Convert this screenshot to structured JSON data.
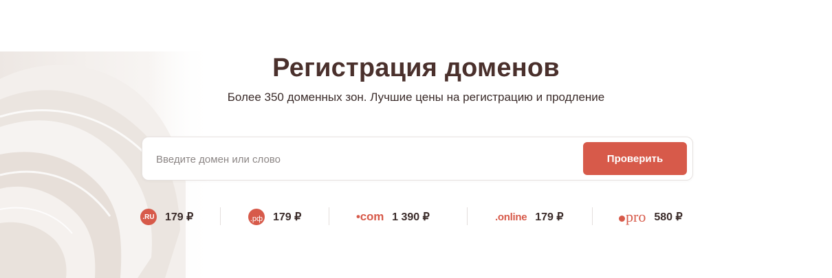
{
  "hero": {
    "title": "Регистрация доменов",
    "subtitle": "Более 350 доменных зон. Лучшие цены на регистрацию и продление"
  },
  "search": {
    "placeholder": "Введите домен или слово",
    "value": "",
    "button_label": "Проверить"
  },
  "zones": [
    {
      "logo_text": ".RU",
      "price": "179 ₽",
      "icon": "ru-zone-logo"
    },
    {
      "logo_text": ".рф",
      "price": "179 ₽",
      "icon": "rf-zone-logo"
    },
    {
      "logo_text": "•com",
      "price": "1 390 ₽",
      "icon": "com-zone-logo"
    },
    {
      "logo_text": ".online",
      "price": "179 ₽",
      "icon": "online-zone-logo"
    },
    {
      "logo_text": "pro",
      "price": "580 ₽",
      "icon": "pro-zone-logo"
    }
  ],
  "colors": {
    "accent": "#d75a4a",
    "title": "#4a302c",
    "text": "#3a2b29",
    "placeholder": "#8b8584"
  }
}
